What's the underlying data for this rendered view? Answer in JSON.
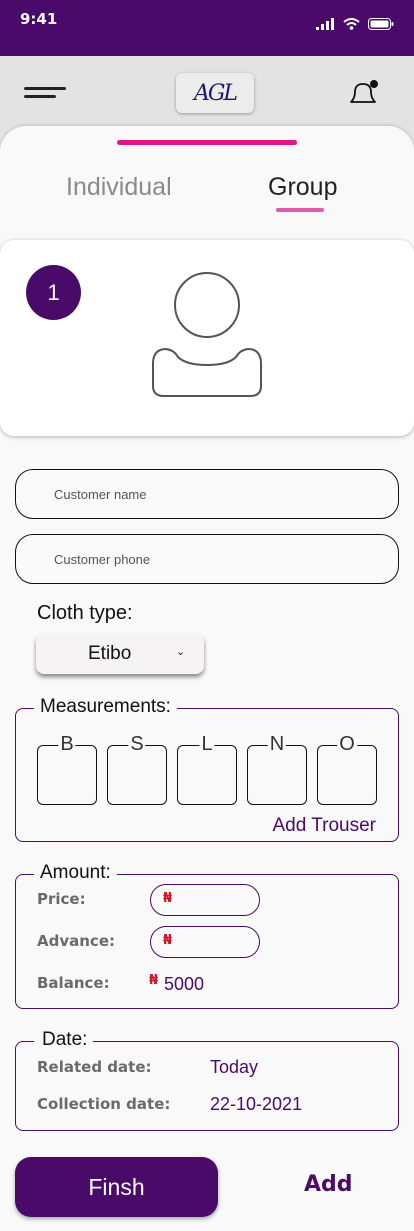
{
  "status_bar": {
    "time": "9:41"
  },
  "header": {
    "logo_text": "AGL",
    "menu_icon": "hamburger-icon",
    "notification_icon": "bell-icon"
  },
  "tabs": [
    {
      "label": "Individual",
      "active": false
    },
    {
      "label": "Group",
      "active": true
    }
  ],
  "profile": {
    "index": "1",
    "avatar_icon": "user-avatar-icon"
  },
  "form": {
    "customer_name_placeholder": "Customer name",
    "customer_phone_placeholder": "Customer phone",
    "cloth_type_label": "Cloth type:",
    "cloth_type_value": "Etibo"
  },
  "measurements": {
    "legend": "Measurements:",
    "slots": [
      "B",
      "S",
      "L",
      "N",
      "O"
    ],
    "add_trouser_label": "Add Trouser"
  },
  "amount": {
    "legend": "Amount:",
    "price_label": "Price:",
    "advance_label": "Advance:",
    "balance_label": "Balance:",
    "currency_symbol": "₦",
    "balance_value": "5000"
  },
  "date": {
    "legend": "Date:",
    "related_label": "Related date:",
    "related_value": "Today",
    "collection_label": "Collection date:",
    "collection_value": "22-10-2021"
  },
  "actions": {
    "finish_label": "Finsh",
    "add_label": "Add"
  },
  "colors": {
    "primary": "#4a0a6a",
    "accent": "#e0158a",
    "currency": "#d01a2a"
  }
}
